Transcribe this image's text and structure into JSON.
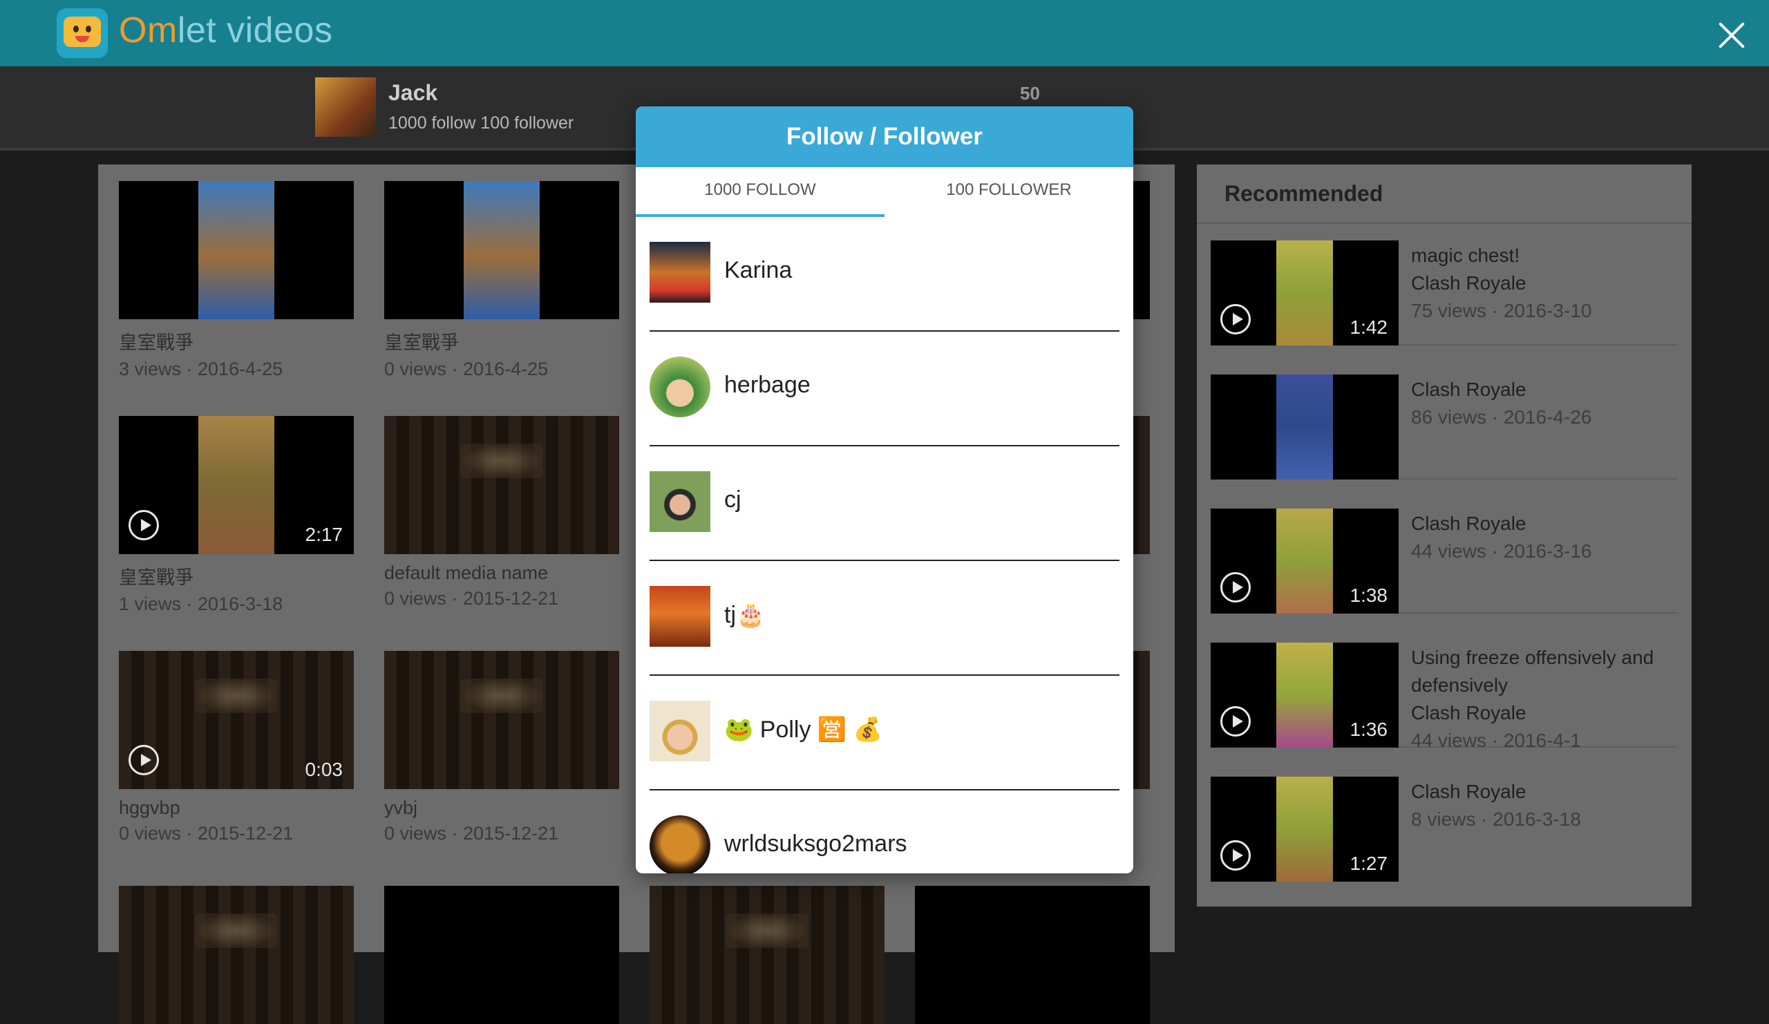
{
  "app": {
    "logo_prefix": "Om",
    "logo_suffix": "let videos"
  },
  "profile": {
    "name": "Jack",
    "stats": "1000 follow 100 follower",
    "count": "50"
  },
  "videos": [
    {
      "title": "皇室戰爭",
      "meta": "3 views · 2016-4-25"
    },
    {
      "title": "皇室戰爭",
      "meta": "0 views · 2016-4-25"
    },
    {
      "title": "皇室戰爭",
      "meta": "1 views · 2016-3-18",
      "duration": "2:17"
    },
    {
      "title": "default media name",
      "meta": "0 views · 2015-12-21"
    },
    {
      "title": "hggvbp",
      "meta": "0 views · 2015-12-21",
      "duration": "0:03"
    },
    {
      "title": "yvbj",
      "meta": "0 views · 2015-12-21"
    }
  ],
  "recommended": {
    "heading": "Recommended",
    "items": [
      {
        "line1": "magic chest!",
        "line2": "Clash Royale",
        "meta": "75 views · 2016-3-10",
        "duration": "1:42"
      },
      {
        "line1": "Clash Royale",
        "meta": "86 views · 2016-4-26"
      },
      {
        "line1": "Clash Royale",
        "meta": "44 views · 2016-3-16",
        "duration": "1:38"
      },
      {
        "line1": "Using freeze offensively and defensively",
        "line2": "Clash Royale",
        "meta": "44 views · 2016-4-1",
        "duration": "1:36"
      },
      {
        "line1": "Clash Royale",
        "meta": "8 views · 2016-3-18",
        "duration": "1:27"
      }
    ]
  },
  "modal": {
    "title": "Follow / Follower",
    "tabs": [
      "1000 FOLLOW",
      "100 FOLLOWER"
    ],
    "users": [
      {
        "name": "Karina"
      },
      {
        "name": "herbage"
      },
      {
        "name": "cj"
      },
      {
        "name": "tj🎂"
      },
      {
        "name": "🐸 Polly 🈺 💰"
      },
      {
        "name": "wrldsuksgo2mars"
      }
    ]
  },
  "colors": {
    "modal_header": "#3aa9d8",
    "topbar": "#17808f",
    "overlay_text": "#2f2f2f"
  },
  "icons": {
    "close": "close-icon",
    "play": "play-icon"
  }
}
